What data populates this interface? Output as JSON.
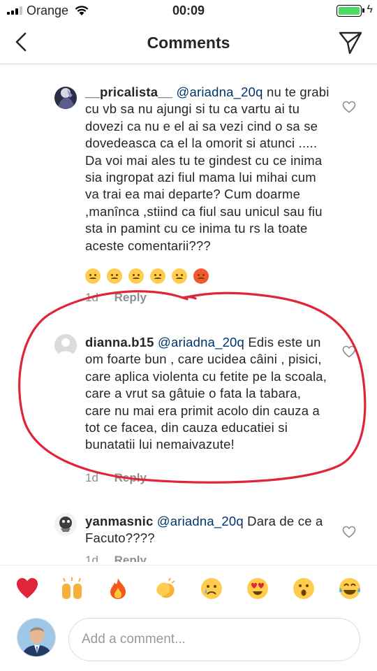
{
  "status_bar": {
    "carrier": "Orange",
    "time": "00:09"
  },
  "header": {
    "title": "Comments"
  },
  "comments": [
    {
      "username": "__pricalista__",
      "mention": "@ariadna_20q",
      "text": " nu te grabi cu vb sa nu ajungi si tu ca vartu ai tu dovezi ca nu e el ai sa vezi cind o sa se dovedeasca ca el la omorit si atunci ..... Da voi mai ales tu te gindest cu ce inima sia ingropat azi fiul mama lui mihai cum va trai ea mai departe? Cum doarme ,manînca ,stiind ca fiul sau unicul sau fiu sta in pamint cu ce inima tu rs la toate aceste comentarii???",
      "time": "1d",
      "reply": "Reply"
    },
    {
      "username": "dianna.b15",
      "mention": "@ariadna_20q",
      "text": " Edis este un om foarte bun , care ucidea câini , pisici, care aplica violenta cu fetite pe la scoala, care a vrut sa gâtuie o fata la tabara, care nu mai era primit acolo din cauza a tot ce facea, din cauza educatiei si bunatatii lui nemaivazute!",
      "time": "1d",
      "reply": "Reply"
    },
    {
      "username": "yanmasnic",
      "mention": "@ariadna_20q",
      "text": " Dara de ce a Facuto????",
      "time": "1d",
      "reply": "Reply"
    }
  ],
  "quick_emojis": [
    "heart-emoji",
    "raised-hands-emoji",
    "fire-emoji",
    "clapping-emoji",
    "crying-emoji",
    "heart-eyes-emoji",
    "surprised-emoji",
    "tears-of-joy-emoji"
  ],
  "comment_input": {
    "placeholder": "Add a comment..."
  },
  "colors": {
    "annotation": "#e0253a",
    "mention": "#003569",
    "battery": "#4cd964"
  }
}
